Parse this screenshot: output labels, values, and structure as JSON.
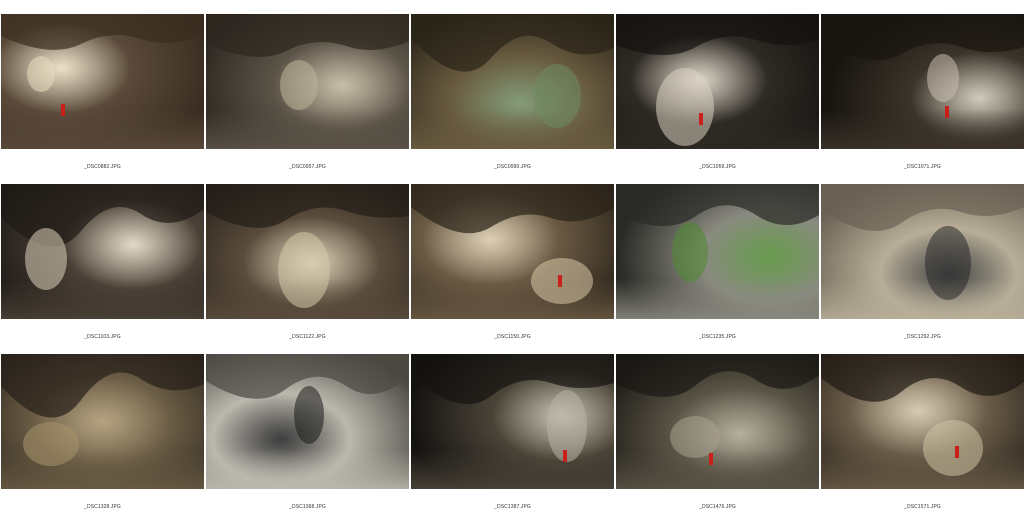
{
  "sheet": {
    "photos": [
      {
        "filename": "_DSC0882.JPG",
        "scene": "cave-hall-stalactite-caver",
        "colors": [
          "#3a2c20",
          "#5a4a3a",
          "#e8dcc0"
        ]
      },
      {
        "filename": "_DSC0957.JPG",
        "scene": "cave-passage-flat-roof",
        "colors": [
          "#2c2620",
          "#5c5448",
          "#bfb49a"
        ]
      },
      {
        "filename": "_DSC0990.JPG",
        "scene": "cave-lake-arch",
        "colors": [
          "#2a2418",
          "#6a5c40",
          "#6e8a60"
        ]
      },
      {
        "filename": "_DSC1059.JPG",
        "scene": "dark-hall-flowstone-caver",
        "colors": [
          "#141210",
          "#2e2a24",
          "#d8d0c0"
        ]
      },
      {
        "filename": "_DSC1071.JPG",
        "scene": "cave-arch-lit-caver",
        "colors": [
          "#181410",
          "#3c342a",
          "#c8c0b0"
        ]
      },
      {
        "filename": "_DSC1103.JPG",
        "scene": "flowstone-curtain",
        "colors": [
          "#1e1a16",
          "#4a4036",
          "#ddd2bc"
        ]
      },
      {
        "filename": "_DSC1122.JPG",
        "scene": "flowstone-and-passage",
        "colors": [
          "#241e18",
          "#5a4c3c",
          "#d6c8aa"
        ]
      },
      {
        "filename": "_DSC1150.JPG",
        "scene": "cave-hall-stalagmite-caver",
        "colors": [
          "#2a2218",
          "#6a5a44",
          "#d8c8a8"
        ]
      },
      {
        "filename": "_DSC1235.JPG",
        "scene": "cave-entrance-greenery",
        "colors": [
          "#2a2a26",
          "#8a8a80",
          "#4e8a30"
        ]
      },
      {
        "filename": "_DSC1292.JPG",
        "scene": "rock-wall-inscriptions",
        "colors": [
          "#6a6254",
          "#b8ae98",
          "#2a2a2a"
        ]
      },
      {
        "filename": "_DSC1328.JPG",
        "scene": "low-ceiling-muddy-floor",
        "colors": [
          "#26201a",
          "#6a5c44",
          "#a8946c"
        ]
      },
      {
        "filename": "_DSC1368.JPG",
        "scene": "graffiti-wall",
        "colors": [
          "#4a4842",
          "#bcb8ae",
          "#1c1c1c"
        ]
      },
      {
        "filename": "_DSC1387.JPG",
        "scene": "tall-chamber-caver",
        "colors": [
          "#141210",
          "#4a4438",
          "#bab4a4"
        ]
      },
      {
        "filename": "_DSC1476.JPG",
        "scene": "jagged-chamber-caver",
        "colors": [
          "#1a1814",
          "#5a5446",
          "#a8a08c"
        ]
      },
      {
        "filename": "_DSC1571.JPG",
        "scene": "boulder-passage-caver",
        "colors": [
          "#201a14",
          "#6a5c48",
          "#cfc2a4"
        ]
      }
    ]
  }
}
